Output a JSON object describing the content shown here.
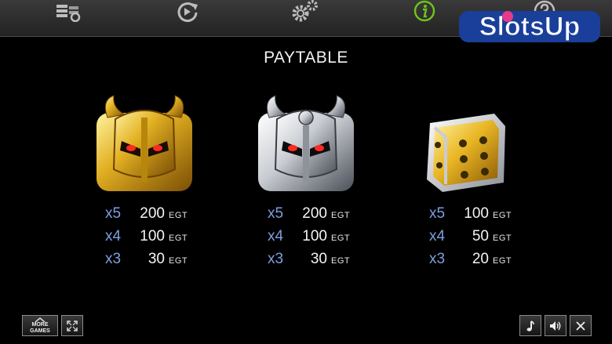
{
  "title": "PAYTABLE",
  "logo_text": "SlotsUp",
  "top_icons": [
    "stack-settings-icon",
    "replay-icon",
    "gears-icon",
    "info-icon",
    "help-icon"
  ],
  "colors": {
    "multiplier": "#7f9fe0",
    "info_active": "#6fc21a",
    "gold": "#e2b022",
    "silver": "#c9ccd2"
  },
  "symbols": [
    {
      "name": "gold-helmet",
      "rows": [
        {
          "mult": "x5",
          "amount": "200",
          "currency": "EGT"
        },
        {
          "mult": "x4",
          "amount": "100",
          "currency": "EGT"
        },
        {
          "mult": "x3",
          "amount": "30",
          "currency": "EGT"
        }
      ]
    },
    {
      "name": "silver-helmet",
      "rows": [
        {
          "mult": "x5",
          "amount": "200",
          "currency": "EGT"
        },
        {
          "mult": "x4",
          "amount": "100",
          "currency": "EGT"
        },
        {
          "mult": "x3",
          "amount": "30",
          "currency": "EGT"
        }
      ]
    },
    {
      "name": "gold-dice",
      "rows": [
        {
          "mult": "x5",
          "amount": "100",
          "currency": "EGT"
        },
        {
          "mult": "x4",
          "amount": "50",
          "currency": "EGT"
        },
        {
          "mult": "x3",
          "amount": "20",
          "currency": "EGT"
        }
      ]
    }
  ],
  "bottom": {
    "more_games_line1": "MORE",
    "more_games_line2": "GAMES"
  },
  "bottom_icons": [
    "fullscreen-icon",
    "music-icon",
    "sound-icon",
    "close-icon"
  ]
}
